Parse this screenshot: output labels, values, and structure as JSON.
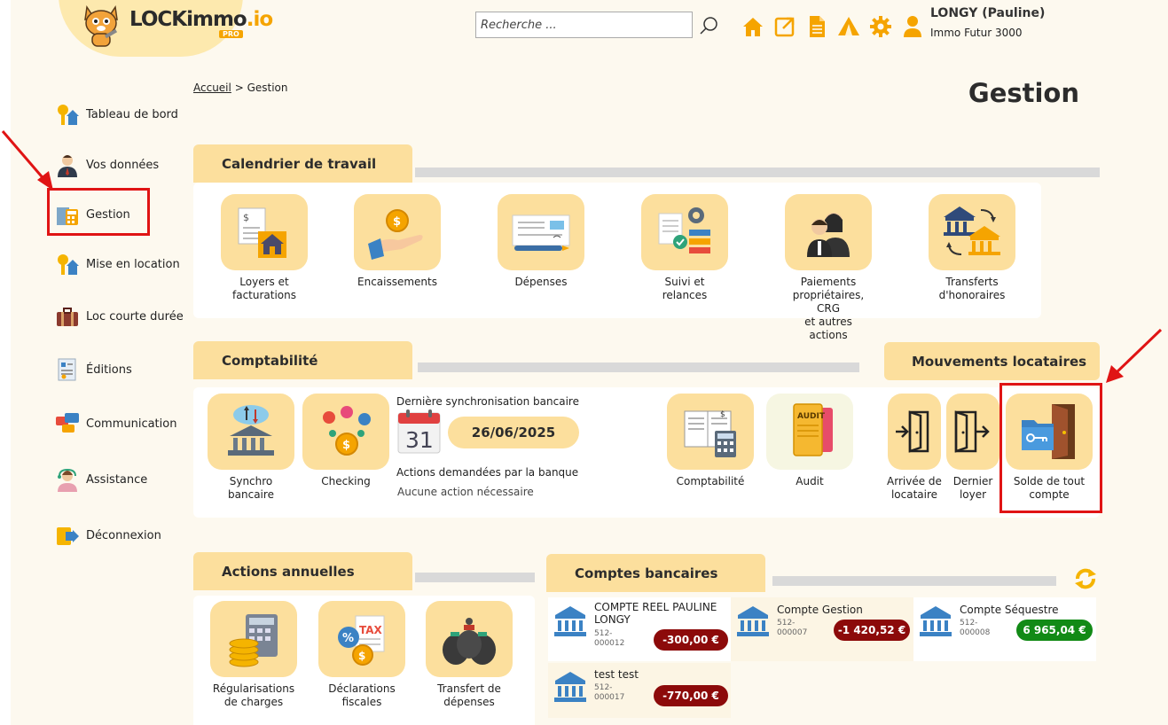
{
  "app": {
    "logo_main": "LOCKimmo",
    "logo_suffix": ".io",
    "logo_badge": "PRO"
  },
  "header": {
    "search_placeholder": "Recherche ...",
    "user_name": "LONGY (Pauline)",
    "user_org": "Immo Futur 3000",
    "icons": [
      "home-icon",
      "external-link-icon",
      "document-icon",
      "tent-icon",
      "gear-icon",
      "user-icon"
    ]
  },
  "sidebar": {
    "items": [
      {
        "label": "Tableau de bord",
        "icon": "keys-house-icon"
      },
      {
        "label": "Vos données",
        "icon": "person-icon"
      },
      {
        "label": "Gestion",
        "icon": "calculator-icon",
        "highlighted": true
      },
      {
        "label": "Mise en location",
        "icon": "keys-house-icon"
      },
      {
        "label": "Loc courte durée",
        "icon": "suitcase-icon"
      },
      {
        "label": "Éditions",
        "icon": "report-icon"
      },
      {
        "label": "Communication",
        "icon": "chat-icon"
      },
      {
        "label": "Assistance",
        "icon": "support-icon"
      },
      {
        "label": "Déconnexion",
        "icon": "logout-icon"
      }
    ]
  },
  "breadcrumb": {
    "home": "Accueil",
    "separator": ">",
    "current": "Gestion"
  },
  "page_title": "Gestion",
  "calendrier": {
    "title": "Calendrier de travail",
    "tiles": [
      {
        "line1": "Loyers et",
        "line2": "facturations",
        "icon": "invoice-house-icon"
      },
      {
        "line1": "Encaissements",
        "line2": "",
        "icon": "coin-hand-icon"
      },
      {
        "line1": "Dépenses",
        "line2": "",
        "icon": "cheque-icon"
      },
      {
        "line1": "Suivi et",
        "line2": "relances",
        "icon": "tracking-icon"
      },
      {
        "line1": "Paiements",
        "line2": "propriétaires, CRG",
        "line3": "et autres actions",
        "icon": "people-icon"
      },
      {
        "line1": "Transferts",
        "line2": "d'honoraires",
        "icon": "bank-transfer-icon"
      }
    ]
  },
  "comptabilite": {
    "title": "Comptabilité",
    "tiles": [
      {
        "line1": "Synchro",
        "line2": "bancaire",
        "icon": "bank-sync-icon"
      },
      {
        "line1": "Checking",
        "line2": "",
        "icon": "coins-network-icon"
      },
      {
        "line1": "Comptabilité",
        "line2": "",
        "icon": "ledger-icon"
      },
      {
        "line1": "Audit",
        "line2": "",
        "icon": "audit-folder-icon"
      }
    ],
    "sync_label": "Dernière synchronisation bancaire",
    "calendar_day": "31",
    "sync_date": "26/06/2025",
    "bank_actions_label": "Actions demandées par la banque",
    "bank_actions_status": "Aucune action nécessaire"
  },
  "mouvements": {
    "title": "Mouvements locataires",
    "tiles": [
      {
        "line1": "Arrivée de",
        "line2": "locataire",
        "icon": "door-enter-icon"
      },
      {
        "line1": "Dernier",
        "line2": "loyer",
        "icon": "door-exit-icon"
      },
      {
        "line1": "Solde de tout",
        "line2": "compte",
        "icon": "key-folder-door-icon",
        "highlighted": true
      }
    ]
  },
  "annuelles": {
    "title": "Actions annuelles",
    "tiles": [
      {
        "line1": "Régularisations",
        "line2": "de charges",
        "icon": "coins-calculator-icon"
      },
      {
        "line1": "Déclarations",
        "line2": "fiscales",
        "icon": "tax-icon"
      },
      {
        "line1": "Transfert de",
        "line2": "dépenses",
        "icon": "money-bags-icon"
      }
    ]
  },
  "comptes": {
    "title": "Comptes bancaires",
    "accounts": [
      {
        "name1": "COMPTE REEL PAULINE",
        "name2": "LONGY",
        "num1": "512-",
        "num2": "000012",
        "amount": "-300,00 €",
        "status": "negative"
      },
      {
        "name1": "Compte Gestion",
        "name2": "",
        "num1": "512-",
        "num2": "000007",
        "amount": "-1 420,52 €",
        "status": "negative"
      },
      {
        "name1": "Compte Séquestre",
        "name2": "",
        "num1": "512-",
        "num2": "000008",
        "amount": "6 965,04 €",
        "status": "positive"
      },
      {
        "name1": "test test",
        "name2": "",
        "num1": "512-",
        "num2": "000017",
        "amount": "-770,00 €",
        "status": "negative"
      }
    ]
  },
  "colors": {
    "accent": "#fcdf9d",
    "page_bg": "#fdf9ef",
    "highlight": "#e01414",
    "negative": "#8c0a0a",
    "positive": "#128a16",
    "icon_orange": "#f5a400"
  }
}
